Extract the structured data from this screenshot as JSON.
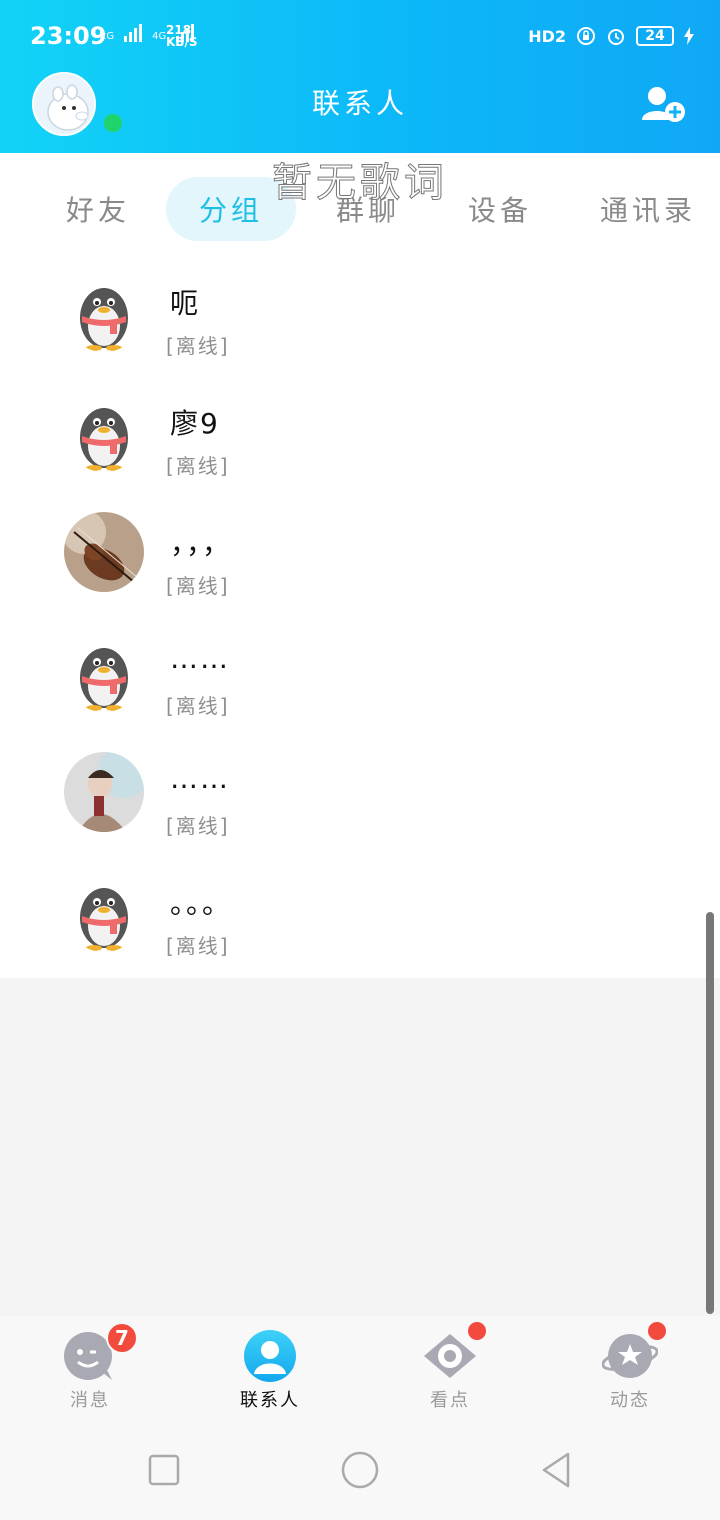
{
  "status_bar": {
    "time": "23:09",
    "network_1": "2G",
    "network_2": "4G",
    "speed_value": "218",
    "speed_unit": "KB/S",
    "hd_label": "HD2",
    "battery": "24"
  },
  "header": {
    "title": "联系人",
    "add_contact_icon": "add-contact-icon",
    "online_status_color": "#1fd46b"
  },
  "lyric_overlay": "暂无歌词",
  "tabs": [
    {
      "label": "好友",
      "active": false
    },
    {
      "label": "分组",
      "active": true
    },
    {
      "label": "群聊",
      "active": false
    },
    {
      "label": "设备",
      "active": false
    },
    {
      "label": "通讯录",
      "active": false
    }
  ],
  "contacts": [
    {
      "name": "呃",
      "status": "[离线]",
      "avatar": "penguin-avatar"
    },
    {
      "name": "廖9",
      "status": "[离线]",
      "avatar": "penguin-avatar"
    },
    {
      "name": "，，，",
      "status": "[离线]",
      "avatar": "violin-photo-avatar"
    },
    {
      "name": "……",
      "status": "[离线]",
      "avatar": "penguin-avatar"
    },
    {
      "name": "……",
      "status": "[离线]",
      "avatar": "person-photo-avatar"
    },
    {
      "name": "。。。",
      "status": "[离线]",
      "avatar": "penguin-avatar"
    }
  ],
  "bottom_nav": [
    {
      "label": "消息",
      "icon": "message-face-icon",
      "badge": "7",
      "active": false
    },
    {
      "label": "联系人",
      "icon": "contacts-person-icon",
      "active": true
    },
    {
      "label": "看点",
      "icon": "eye-icon",
      "dot": true,
      "active": false
    },
    {
      "label": "动态",
      "icon": "planet-star-icon",
      "dot": true,
      "active": false
    }
  ],
  "colors": {
    "header_gradient_start": "#12d3f7",
    "header_gradient_end": "#10a8f6",
    "active_tab_text": "#1ebfe6",
    "badge_red": "#f24a3d"
  }
}
